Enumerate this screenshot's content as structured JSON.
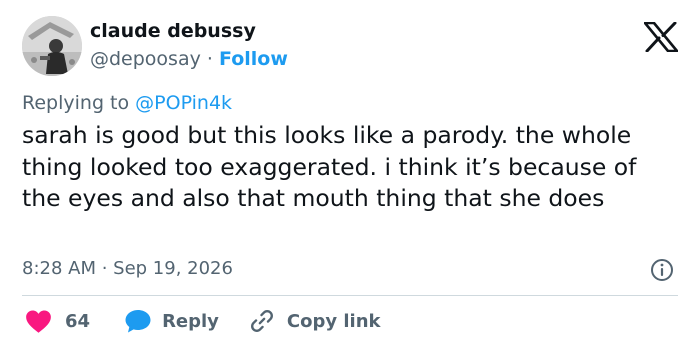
{
  "author": {
    "name": "claude debussy",
    "handle": "@depoosay",
    "separator": "·",
    "follow_label": "Follow"
  },
  "brand": {
    "logo_icon": "x-logo-icon"
  },
  "reply_context": {
    "prefix": "Replying to",
    "mention": "@POPin4k"
  },
  "tweet": {
    "text": "sarah is good but this looks like a parody. the whole thing looked too exaggerated. i think it’s because of the eyes and also that mouth thing that she does",
    "timestamp": "8:28 AM · Sep 19, 2026"
  },
  "actions": {
    "like_count": "64",
    "reply_label": "Reply",
    "copy_link_label": "Copy link"
  },
  "icons": {
    "like": "heart-icon",
    "reply": "speech-bubble-icon",
    "copy_link": "link-icon",
    "info": "info-icon"
  },
  "colors": {
    "accent": "#1d9bf0",
    "like": "#f91880",
    "text": "#0f1419",
    "muted": "#536471"
  }
}
